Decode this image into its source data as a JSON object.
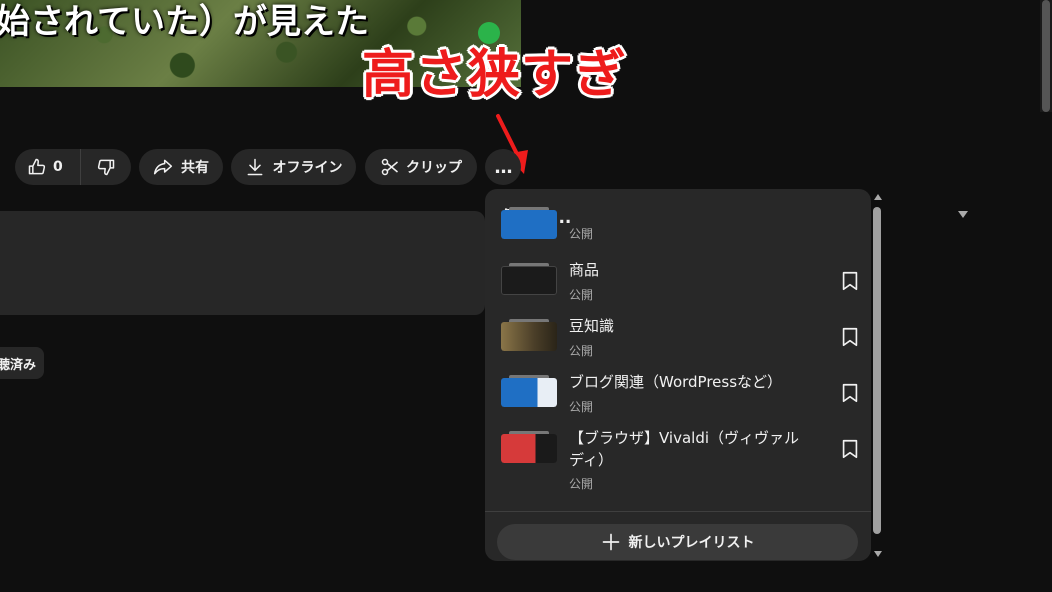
{
  "video": {
    "caption": "始されていた）が見えた"
  },
  "annotation": {
    "text": "高さ狭すぎ",
    "color": "#ee1c1c"
  },
  "actions": {
    "like_count": "0",
    "share_label": "共有",
    "offline_label": "オフライン",
    "clip_label": "クリップ",
    "more_label": "…"
  },
  "chip": {
    "label": "聴済み"
  },
  "save_popup": {
    "title": "保存先...",
    "partial_item_visibility": "公開",
    "items": [
      {
        "name": "商品",
        "visibility": "公開",
        "thumb_color": "#1b1b1b"
      },
      {
        "name": "豆知識",
        "visibility": "公開",
        "thumb_color": "#6b5a3a"
      },
      {
        "name": "ブログ関連（WordPressなど）",
        "visibility": "公開",
        "thumb_color": "#1f6fc4"
      },
      {
        "name": "【ブラウザ】Vivaldi（ヴィヴァルディ）",
        "visibility": "公開",
        "thumb_color": "#d63a3a"
      }
    ],
    "new_playlist_label": "新しいプレイリスト"
  }
}
